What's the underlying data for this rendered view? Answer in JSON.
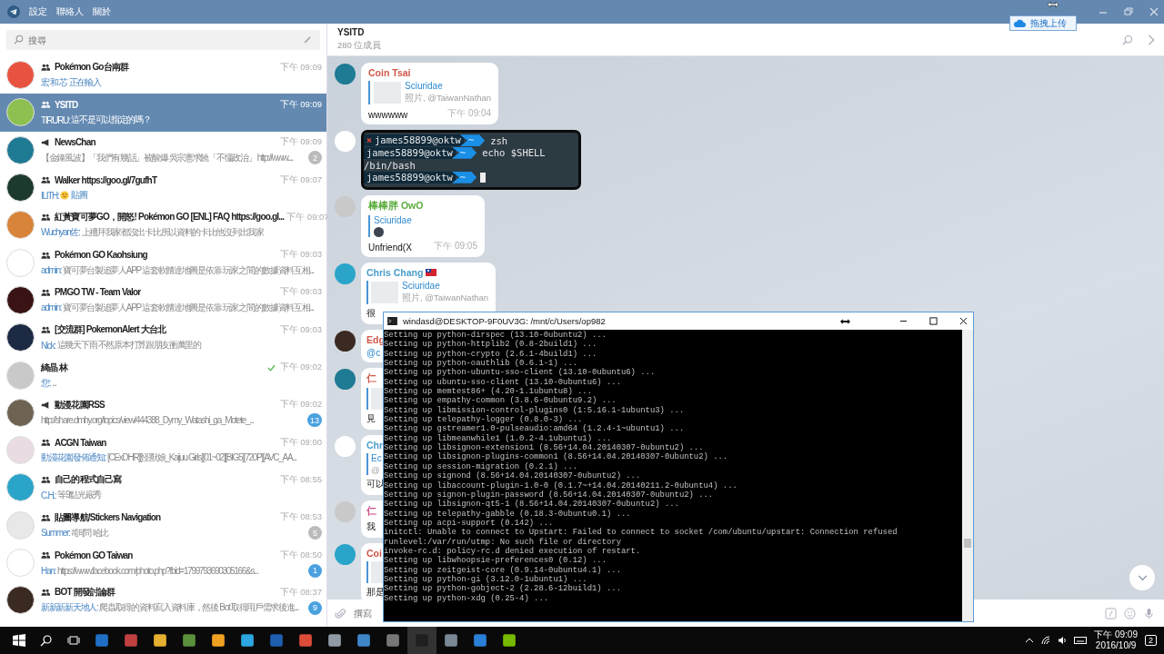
{
  "menu": [
    {
      "label": "設定"
    },
    {
      "label": "聯絡人"
    },
    {
      "label": "關於"
    }
  ],
  "upload_button": {
    "label": "拖拽上传"
  },
  "search": {
    "placeholder": "搜尋"
  },
  "chats": [
    {
      "name": "Pokémon Go台南群",
      "kind": "group",
      "time": "下午 09:09",
      "preview": {
        "kind": "typing",
        "sender": "宏 和 芯 正在輸入"
      },
      "selected": false,
      "read_check": false
    },
    {
      "name": "YSITD",
      "kind": "group",
      "time": "下午 09:09",
      "preview": {
        "kind": "text",
        "sender": "TIRURU:",
        "text": "這不是可以指定的嗎？"
      },
      "selected": true,
      "read_check": false
    },
    {
      "name": "NewsChan",
      "kind": "channel",
      "time": "下午 09:09",
      "preview": {
        "kind": "text",
        "text": "【金鐘風波】「我們有幾話」被酸爆 吳宗憲求饒「不懂政治」 http://www...."
      },
      "badge": {
        "count": "2",
        "muted": true
      },
      "selected": false,
      "read_check": false
    },
    {
      "name": "Walker https://goo.gl/7gufhT",
      "kind": "group",
      "time": "下午 09:07",
      "preview": {
        "kind": "sticker",
        "sender": "ILITH:",
        "text": "貼圖"
      },
      "selected": false,
      "read_check": false
    },
    {
      "name": "紅黃寶可夢GO，開怒! Pokémon GO [ENL] FAQ https://goo.gl...",
      "kind": "group",
      "time": "下午 09:07",
      "preview": {
        "kind": "text",
        "sender": "Wuchyan佐:",
        "text": "上禮拜我家都沒出卡比所以資料的卡比他沒列出我家"
      },
      "selected": false,
      "read_check": false
    },
    {
      "name": "Pokémon GO Kaohsiung",
      "kind": "group",
      "time": "下午 09:03",
      "preview": {
        "kind": "text",
        "sender": "admin:",
        "text": "寶可夢台製追夢人APP 這套軟體達地圖是依靠 玩家之間的數據資料互相..."
      },
      "selected": false,
      "read_check": false
    },
    {
      "name": "PMGO TW - Team Valor",
      "kind": "group",
      "time": "下午 09:03",
      "preview": {
        "kind": "text",
        "sender": "admin:",
        "text": "寶可夢台製追夢人APP 這套軟體達地圖是依靠 玩家之間的數據資料互相..."
      },
      "selected": false,
      "read_check": false
    },
    {
      "name": "[交流群] PokemonAlert 大台北",
      "kind": "group",
      "time": "下午 09:03",
      "preview": {
        "kind": "text",
        "sender": "Nick:",
        "text": "這幾天下雨 不然原本打算跟朋友衝萬里的"
      },
      "selected": false,
      "read_check": false
    },
    {
      "name": "綺晶 林",
      "kind": "user",
      "time": "下午 09:02",
      "preview": {
        "kind": "text",
        "sender": "您:",
        "text": "..."
      },
      "selected": false,
      "read_check": true
    },
    {
      "name": "動漫花園RSS",
      "kind": "channel",
      "time": "下午 09:02",
      "preview": {
        "kind": "text",
        "text": "http://share.dmhy.org/topics/view/444388_Dymy_Watashi_ga_Motete_..."
      },
      "badge": {
        "count": "13",
        "muted": false
      },
      "selected": false,
      "read_check": false
    },
    {
      "name": "ACGN Taiwan",
      "kind": "group",
      "time": "下午 09:00",
      "preview": {
        "kind": "text",
        "sender": "動漫花園發佈通知:",
        "text": "[CExDHR][怪獸娘_Kaijuu Girls][01~02][BIG5][720P][AVC_AA..."
      },
      "selected": false,
      "read_check": false
    },
    {
      "name": "自己的程式自己寫",
      "kind": "group",
      "time": "下午 08:55",
      "preview": {
        "kind": "text",
        "sender": "C.H.:",
        "text": "等9點光嚴秀"
      },
      "selected": false,
      "read_check": false
    },
    {
      "name": "貼圖導航/Stickers Navigation",
      "kind": "group",
      "time": "下午 08:53",
      "preview": {
        "kind": "text",
        "sender": "Summer:",
        "text": "#詢問 哈比"
      },
      "badge": {
        "count": "5",
        "muted": true
      },
      "selected": false,
      "read_check": false
    },
    {
      "name": "Pokémon GO Taiwan",
      "kind": "group",
      "time": "下午 08:50",
      "preview": {
        "kind": "text",
        "sender": "Han:",
        "text": "https://www.facebook.com/photo.php?fbid=1799793690305166&s..."
      },
      "badge": {
        "count": "1",
        "muted": false
      },
      "selected": false,
      "read_check": false
    },
    {
      "name": "BOT 開發討論群",
      "kind": "group",
      "time": "下午 08:37",
      "preview": {
        "kind": "text",
        "sender": "新新新新天地人:",
        "text": "爬蟲取得的資料寫入資料庫，然後 Bot 取得用戶需求後進..."
      },
      "badge": {
        "count": "9",
        "muted": false
      },
      "selected": false,
      "read_check": false
    }
  ],
  "chat_header": {
    "title": "YSITD",
    "subtitle": "280 位成員"
  },
  "messages": [
    {
      "kind": "text",
      "sender": "Coin Tsai",
      "color": "#d0574a",
      "flag": false,
      "reply": {
        "title": "Sciuridae",
        "subtitle": "照片, @TaiwanNathan",
        "kind": "photo"
      },
      "text": "wwwwww",
      "time": "下午 09:04"
    },
    {
      "kind": "terminal",
      "lines": [
        {
          "kind": "prompt",
          "error": true,
          "user": "james58899@oktw",
          "dir": "~",
          "command": "zsh",
          "cursor": false
        },
        {
          "kind": "prompt",
          "error": false,
          "user": "james58899@oktw",
          "dir": "~",
          "command": "echo $SHELL",
          "cursor": false
        },
        {
          "kind": "output",
          "text": "/bin/bash"
        },
        {
          "kind": "prompt",
          "error": false,
          "user": "james58899@oktw",
          "dir": "~",
          "cursor": true
        }
      ]
    },
    {
      "kind": "text",
      "sender": "棒棒胖 OwO",
      "color": "#5aac3c",
      "flag": false,
      "reply": {
        "title": "Sciuridae",
        "kind": "sticker"
      },
      "text": "Unfriend(X",
      "time": "下午 09:05"
    },
    {
      "kind": "text",
      "sender": "Chris Chang",
      "color": "#4a9ec9",
      "flag": true,
      "reply": {
        "title": "Sciuridae",
        "subtitle": "照片, @TaiwanNathan",
        "kind": "photo"
      },
      "text": "很"
    },
    {
      "kind": "text",
      "sender": "Edg",
      "color": "#d0574a",
      "flag": false,
      "mention": "@c"
    },
    {
      "kind": "text",
      "sender": "仁",
      "color": "#d0574a",
      "flag": false,
      "reply": {
        "kind": "photo"
      },
      "text": "見"
    },
    {
      "kind": "text",
      "sender": "Chr",
      "color": "#4a9ec9",
      "flag": false,
      "reply": {
        "title": "Ec",
        "subtitle": "@",
        "kind": "text"
      },
      "text": "可以"
    },
    {
      "kind": "text",
      "sender": "仁",
      "color": "#c9508a",
      "flag": false,
      "text": "我"
    },
    {
      "kind": "text",
      "sender": "Coi",
      "color": "#d0574a",
      "flag": false,
      "reply": {
        "kind": "photo"
      },
      "text": "那是"
    }
  ],
  "compose": {
    "placeholder": "撰寫"
  },
  "terminal": {
    "title": "windasd@DESKTOP-9F0UV3G: /mnt/c/Users/op982",
    "lines": [
      "Setting up python-dirspec (13.10-0ubuntu2) ...",
      "Setting up python-httplib2 (0.8-2build1) ...",
      "Setting up python-crypto (2.6.1-4build1) ...",
      "Setting up python-oauthlib (0.6.1-1) ...",
      "Setting up python-ubuntu-sso-client (13.10-0ubuntu6) ...",
      "Setting up ubuntu-sso-client (13.10-0ubuntu6) ...",
      "Setting up memtest86+ (4.20-1.1ubuntu8) ...",
      "Setting up empathy-common (3.8.6-0ubuntu9.2) ...",
      "Setting up libmission-control-plugins0 (1:5.16.1-1ubuntu3) ...",
      "Setting up telepathy-logger (0.8.0-3) ...",
      "Setting up gstreamer1.0-pulseaudio:amd64 (1.2.4-1~ubuntu1) ...",
      "Setting up libmeanwhile1 (1.0.2-4.1ubuntu1) ...",
      "Setting up libsignon-extension1 (8.56+14.04.20140307-0ubuntu2) ...",
      "Setting up libsignon-plugins-common1 (8.56+14.04.20140307-0ubuntu2) ...",
      "Setting up session-migration (0.2.1) ...",
      "Setting up signond (8.56+14.04.20140307-0ubuntu2) ...",
      "Setting up libaccount-plugin-1.0-0 (0.1.7~+14.04.20140211.2-0ubuntu4) ...",
      "Setting up signon-plugin-password (8.56+14.04.20140307-0ubuntu2) ...",
      "Setting up libsignon-qt5-1 (8.56+14.04.20140307-0ubuntu2) ...",
      "Setting up telepathy-gabble (0.18.3-0ubuntu0.1) ...",
      "Setting up acpi-support (0.142) ...",
      "initctl: Unable to connect to Upstart: Failed to connect to socket /com/ubuntu/upstart: Connection refused",
      "runlevel:/var/run/utmp: No such file or directory",
      "invoke-rc.d: policy-rc.d denied execution of restart.",
      "Setting up libwhoopsie-preferences0 (0.12) ...",
      "Setting up zeitgeist-core (0.9.14-0ubuntu4.1) ...",
      "Setting up python-gi (3.12.0-1ubuntu1) ...",
      "Setting up python-gobject-2 (2.28.6-12build1) ...",
      "Setting up python-xdg (0.25-4) ..."
    ]
  },
  "taskbar": {
    "time": "下午 09:09",
    "date": "2016/10/9",
    "notifications": "2"
  }
}
